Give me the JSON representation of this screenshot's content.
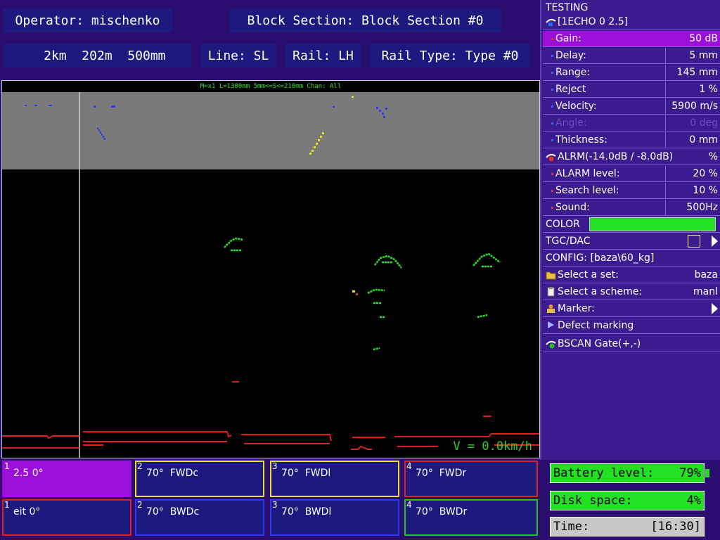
{
  "header": {
    "operator": "Operator: mischenko",
    "block_section": "Block Section: Block Section #0",
    "distance": "  2km  202m  500mm",
    "line": "Line: SL",
    "rail": "Rail: LH",
    "rail_type": "Rail Type: Type #0"
  },
  "scan": {
    "header_text": "M=x1  L=1300mm 5mm<=S<=210mm Chan: All",
    "speed": "V = 0.0km/h"
  },
  "panel": {
    "title": "TESTING",
    "echo": "[1ECHO 0 2.5]",
    "gain_label": "Gain:",
    "gain_value": "50 dB",
    "delay_label": "Delay:",
    "delay_value": "5 mm",
    "range_label": "Range:",
    "range_value": "145 mm",
    "reject_label": "Reject",
    "reject_value": "1 %",
    "velocity_label": "Velocity:",
    "velocity_value": "5900 m/s",
    "angle_label": "Angle:",
    "angle_value": "0 deg",
    "thickness_label": "Thickness:",
    "thickness_value": "0 mm",
    "alarm_label": "ALRM(-14.0dB / -8.0dB)",
    "alarm_value": "%",
    "alarm_level_label": "ALARM level:",
    "alarm_level_value": "20 %",
    "search_level_label": "Search level:",
    "search_level_value": "10 %",
    "sound_label": "Sound:",
    "sound_value": "500Hz",
    "color_label": "COLOR",
    "tgc_label": "TGC/DAC",
    "config_label": "CONFIG: [baza\\60_kg]",
    "select_set_label": "Select a set:",
    "select_set_value": "baza",
    "select_scheme_label": "Select a scheme:",
    "select_scheme_value": "manl",
    "marker_label": "Marker:",
    "defect_marking_label": "Defect marking",
    "bscan_gate_label": "BSCAN Gate(+,-)"
  },
  "channels": [
    {
      "num": "1",
      "name": "2.5 0°"
    },
    {
      "num": "2",
      "name": "70°  FWDc"
    },
    {
      "num": "3",
      "name": "70°  FWDl"
    },
    {
      "num": "4",
      "name": "70°  FWDr"
    },
    {
      "num": "1",
      "name": "eit 0°"
    },
    {
      "num": "2",
      "name": "70°  BWDc"
    },
    {
      "num": "3",
      "name": "70°  BWDl"
    },
    {
      "num": "4",
      "name": "70°  BWDr"
    }
  ],
  "status": {
    "battery_label": "Battery level:",
    "battery_value": "79%",
    "disk_label": "Disk space:",
    "disk_value": "4%",
    "time_label": "Time:",
    "time_value": "[16:30]"
  },
  "colors": {
    "accent_green": "#22e022",
    "selected_purple": "#9a10d8",
    "panel_bg": "#3b1b8e"
  }
}
